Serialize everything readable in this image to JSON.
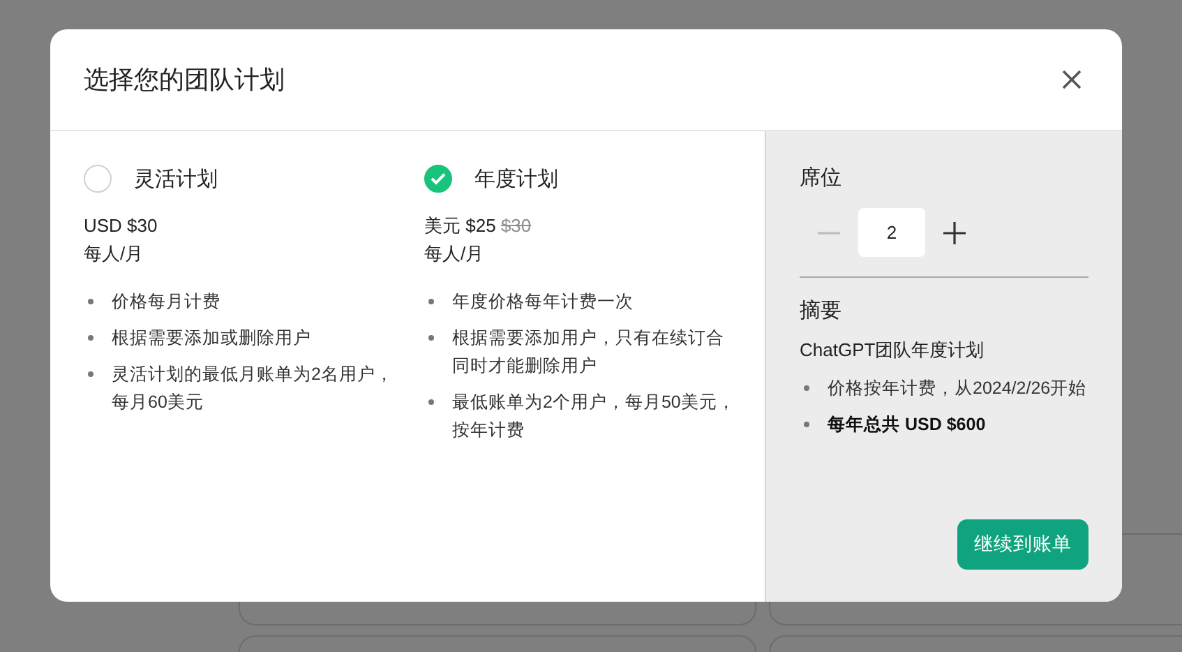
{
  "dialog": {
    "title": "选择您的团队计划"
  },
  "plans": [
    {
      "name": "灵活计划",
      "selected": false,
      "price": "USD $30",
      "period": "每人/月",
      "features": [
        "价格每月计费",
        "根据需要添加或删除用户",
        "灵活计划的最低月账单为2名用户，每月60美元"
      ]
    },
    {
      "name": "年度计划",
      "selected": true,
      "price": "美元 $25",
      "original_price": "$30",
      "period": "每人/月",
      "features": [
        "年度价格每年计费一次",
        "根据需要添加用户，只有在续订合同时才能删除用户",
        "最低账单为2个用户，每月50美元，按年计费"
      ]
    }
  ],
  "seats": {
    "label": "席位",
    "value": "2",
    "decrease_disabled": true
  },
  "summary": {
    "title": "摘要",
    "plan": "ChatGPT团队年度计划",
    "items": [
      {
        "text": "价格按年计费，从2024/2/26开始",
        "bold": false
      },
      {
        "text": "每年总共 USD $600",
        "bold": true
      }
    ]
  },
  "continue_button": "继续到账单"
}
